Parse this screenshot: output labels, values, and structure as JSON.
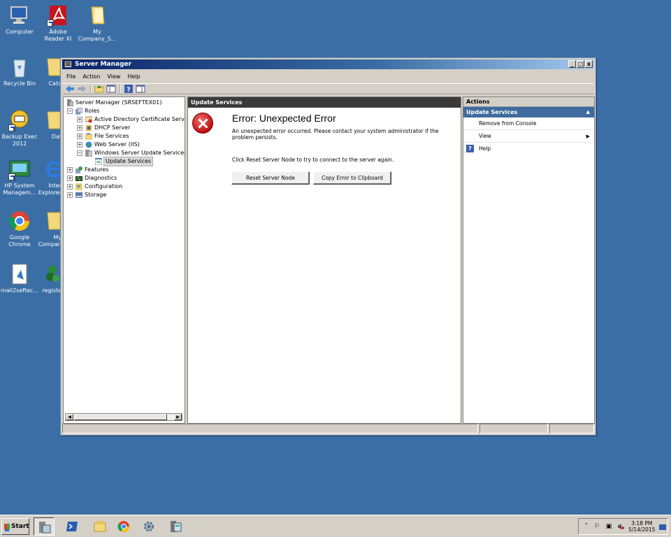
{
  "desktop": {
    "icons": [
      {
        "label": "Computer",
        "icon": "computer-icon"
      },
      {
        "label": "Adobe Reader XI",
        "icon": "adobe-reader-icon"
      },
      {
        "label": "My Company_S...",
        "icon": "folder-icon"
      },
      {
        "label": "Recycle Bin",
        "icon": "recycle-bin-icon"
      },
      {
        "label": "Cata",
        "icon": "folder-icon"
      },
      {
        "label": "Backup Exec 2012",
        "icon": "backup-exec-icon"
      },
      {
        "label": "Dat",
        "icon": "folder-icon"
      },
      {
        "label": "HP System Managem...",
        "icon": "hp-system-icon"
      },
      {
        "label": "Inter Explorer",
        "icon": "internet-explorer-icon"
      },
      {
        "label": "Google Chrome",
        "icon": "chrome-icon"
      },
      {
        "label": "My Compan",
        "icon": "folder-icon"
      },
      {
        "label": "mail2seftec...",
        "icon": "mail-file-icon"
      },
      {
        "label": "registe",
        "icon": "register-icon"
      }
    ]
  },
  "window": {
    "title": "Server Manager",
    "menu": [
      "File",
      "Action",
      "View",
      "Help"
    ],
    "controls": {
      "minimize": "_",
      "maximize": "□",
      "close": "x"
    }
  },
  "tree": {
    "items": [
      {
        "label": "Server Manager (SRSEFTEX01)",
        "icon": "server-manager-icon"
      },
      {
        "label": "Roles",
        "icon": "roles-icon"
      },
      {
        "label": "Active Directory Certificate Service",
        "icon": "certificate-icon"
      },
      {
        "label": "DHCP Server",
        "icon": "dhcp-icon"
      },
      {
        "label": "File Services",
        "icon": "file-services-icon"
      },
      {
        "label": "Web Server (IIS)",
        "icon": "web-server-icon"
      },
      {
        "label": "Windows Server Update Services",
        "icon": "wsus-icon"
      },
      {
        "label": "Update Services",
        "icon": "update-services-icon"
      },
      {
        "label": "Features",
        "icon": "features-icon"
      },
      {
        "label": "Diagnostics",
        "icon": "diagnostics-icon"
      },
      {
        "label": "Configuration",
        "icon": "configuration-icon"
      },
      {
        "label": "Storage",
        "icon": "storage-icon"
      }
    ],
    "selected": "Update Services"
  },
  "main": {
    "header": "Update Services",
    "error_title": "Error: Unexpected Error",
    "error_message": "An unexpected error occurred. Please contact your system administrator if the problem persists.",
    "hint": "Click Reset Server Node to try to connect to the server again.",
    "buttons": {
      "reset": "Reset Server Node",
      "copy": "Copy Error to Clipboard"
    }
  },
  "actions": {
    "header": "Actions",
    "section": "Update Services",
    "items": [
      {
        "label": "Remove from Console"
      },
      {
        "label": "View"
      },
      {
        "label": "Help"
      }
    ]
  },
  "taskbar": {
    "start_label": "Start",
    "apps": [
      "server-manager-icon",
      "powershell-icon",
      "explorer-icon",
      "chrome-icon",
      "control-panel-icon",
      "wsus-icon"
    ],
    "clock_time": "3:18 PM",
    "clock_date": "5/14/2015"
  }
}
